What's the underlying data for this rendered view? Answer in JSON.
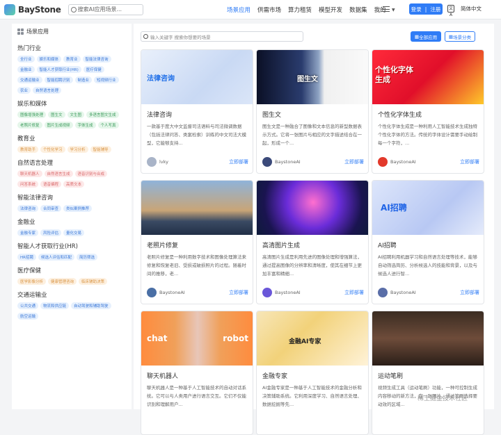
{
  "header": {
    "logo_text": "BayStone",
    "search_placeholder": "搜索AI应用场景...",
    "nav": [
      "场景应用",
      "供需市场",
      "算力租赁",
      "模型开发",
      "数据集",
      "我的"
    ],
    "login_label": "登录",
    "register_label": "注册",
    "lang_icon": "文A",
    "lang_label": "简体中文"
  },
  "sidebar": {
    "title": "场景应用",
    "categories": [
      {
        "name": "热门行业",
        "color": "blue",
        "tags": [
          "全行业",
          "娱乐和媒体",
          "教育业",
          "智能法律咨询",
          "金融业",
          "智能人才获取行业(HR)",
          "医疗保健",
          "交通运输业",
          "智能招聘识别",
          "制造业",
          "短视频行业",
          "农业",
          "自然语言处理"
        ]
      },
      {
        "name": "娱乐和媒体",
        "color": "green",
        "tags": [
          "图像增强处理",
          "图生文",
          "文生图",
          "多语言图文生成",
          "老照片修复",
          "图片生成视频",
          "字体生成",
          "个人写真"
        ]
      },
      {
        "name": "教育业",
        "color": "orange",
        "tags": [
          "教育助手",
          "个性化学习",
          "学习分析",
          "智能辅导"
        ]
      },
      {
        "name": "自然语言处理",
        "color": "red",
        "tags": [
          "聊天机器人",
          "自然语言生成",
          "语音识别与合成",
          "问答系统",
          "语音编程",
          "高质文本"
        ]
      },
      {
        "name": "智能法律咨询",
        "color": "blue",
        "tags": [
          "法律咨询",
          "合同审查",
          "类似案例推荐"
        ]
      },
      {
        "name": "金融业",
        "color": "blue",
        "tags": [
          "金融专家",
          "风险评估",
          "量化交易"
        ]
      },
      {
        "name": "智能人才获取行业(HR)",
        "color": "blue",
        "tags": [
          "HR招聘",
          "候选人评估和匹配",
          "简历筛选"
        ]
      },
      {
        "name": "医疗保健",
        "color": "orange",
        "tags": [
          "医学影像分析",
          "健康管理咨询",
          "临床辅助决策"
        ]
      },
      {
        "name": "交通运输业",
        "color": "blue",
        "tags": [
          "公共交通",
          "物流和供应链",
          "自动驾驶和辅助驾驶",
          "航空运输"
        ]
      }
    ]
  },
  "main": {
    "search_placeholder": "输入关键字 搜索你想要的场景",
    "btn_all": "全部应用",
    "btn_category": "场景分类",
    "cards": [
      {
        "thumb_text": "法律咨询",
        "title": "法律咨询",
        "desc": "一款基于度大中文监督司法语料与司法微调数据（包括法律问答、类案检索）训练的中文司法大模型，它能够支持...",
        "author": "lvky",
        "deploy": "立即部署"
      },
      {
        "thumb_text": "图生文",
        "title": "图生文",
        "desc": "图生文是一种融合了图像和文本信息的新型数据表示方式。它将一张图片与相应的文字描述结合在一起，形成一个...",
        "author": "BaystoneAI",
        "deploy": "立即部署"
      },
      {
        "thumb_text": "个性化字体生成",
        "title": "个性化字体生成",
        "desc": "个性化字体生成是一种利用人工智能技术生成独特个性化字体的方法。传统的字体设计需要手动绘制每一个字符，...",
        "author": "BaystoneAI",
        "deploy": "立即部署"
      },
      {
        "thumb_text": "",
        "title": "老照片修复",
        "desc": "老照片修复是一种利用数字技术和图像处理算法来修复和恢复老旧、受损或破损照片的过程。随着时间的推移，老...",
        "author": "BaystoneAI",
        "deploy": "立即部署"
      },
      {
        "thumb_text": "",
        "title": "高清图片生成",
        "desc": "高清图片生成是利用先进的图像处理和增强算法，通过提高图像的分辨率和清晰度，使其在细节上更加丰富和精细...",
        "author": "BaystoneAI",
        "deploy": "立即部署"
      },
      {
        "thumb_text": "AI招聘",
        "title": "AI招聘",
        "desc": "AI招聘利用机器学习和自然语言处理等技术，能够自动筛选简历、分析候选人的技能和背景，以及与候选人进行智...",
        "author": "BaystoneAI",
        "deploy": "立即部署"
      },
      {
        "thumb_text": "chat robot",
        "title": "聊天机器人",
        "desc": "聊天机器人是一种基于人工智能技术的自动对话系统。它可以与人类用户进行语言交互。它们不仅能识别和理解用户...",
        "author": "",
        "deploy": ""
      },
      {
        "thumb_text": "金融AI专家",
        "title": "金融专家",
        "desc": "AI金融专家是一种基于人工智能技术的金融分析和决策辅助系统。它利用深度学习、自然语言处理、数据挖掘等先...",
        "author": "",
        "deploy": ""
      },
      {
        "thumb_text": "",
        "title": "运动笔刷",
        "desc": "视频生成工具（运动笔刷）功能，一种可控制生成内容移动的新方法，在一张图片，通过笔刷选择要动效的区域...",
        "author": "",
        "deploy": ""
      }
    ]
  },
  "watermark": "稀土掘金技术社区"
}
